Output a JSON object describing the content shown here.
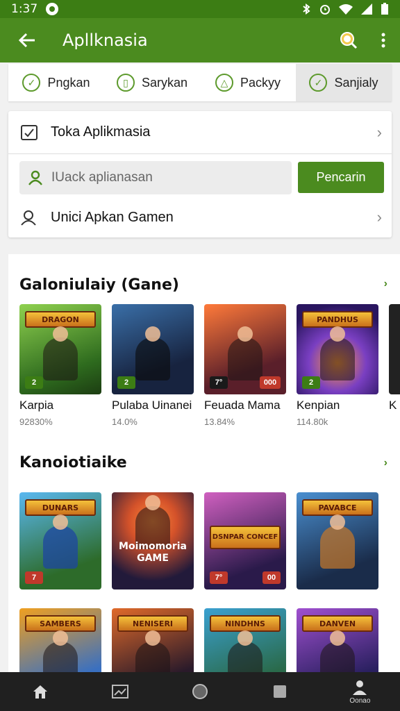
{
  "status_bar": {
    "time": "1:37"
  },
  "app_bar": {
    "title": "Apllknasia",
    "back_icon": "arrow-left-icon",
    "search_icon": "search-icon",
    "more_icon": "more-vert-icon"
  },
  "tabs": [
    {
      "label": "Pngkan",
      "icon": "check-circle-icon",
      "active": false
    },
    {
      "label": "Sarykan",
      "icon": "bag-icon",
      "active": false
    },
    {
      "label": "Packyy",
      "icon": "alert-icon",
      "active": false
    },
    {
      "label": "Sanjialy",
      "icon": "check-circle-icon",
      "active": true
    }
  ],
  "tools": {
    "toka_label": "Toka Aplikmasia",
    "search_placeholder": "IUack aplianasan",
    "search_button": "Pencarin",
    "games_label": "Unici Apkan Gamen"
  },
  "section1": {
    "title": "Galoniulaiy (Gane)",
    "games": [
      {
        "name": "Karpia",
        "stat": "92830%",
        "banner": "DRAGON",
        "badge_left": "2",
        "badge_right": "",
        "colors": [
          "#6fbf3a",
          "#2e6b1e"
        ]
      },
      {
        "name": "Pulaba Uinanei",
        "stat": "14.0%",
        "banner": "",
        "badge_left": "2",
        "badge_right": "",
        "colors": [
          "#274a78",
          "#17233f"
        ]
      },
      {
        "name": "Feuada Mama",
        "stat": "13.84%",
        "banner": "",
        "badge_left": "7°",
        "badge_right": "000",
        "colors": [
          "#e0502a",
          "#5a1f2a"
        ]
      },
      {
        "name": "Kenpian",
        "stat": "114.80k",
        "banner": "PANDHUS",
        "badge_left": "2",
        "badge_right": "",
        "colors": [
          "#7a3fc2",
          "#2a1660"
        ]
      },
      {
        "name": "K",
        "stat": "",
        "banner": "",
        "badge_left": "",
        "badge_right": "",
        "colors": [
          "#333",
          "#111"
        ]
      }
    ]
  },
  "section2": {
    "title": "Kanoiotiaike",
    "games": [
      {
        "banner": "DUNARS",
        "text": "",
        "badge_left": "7",
        "badge_right": "",
        "colors": [
          "#3a9bd8",
          "#2d6b2a"
        ]
      },
      {
        "banner": "",
        "text": "Moimomoria GAME",
        "badge_left": "",
        "badge_right": "",
        "colors": [
          "#d4522a",
          "#221a3a"
        ]
      },
      {
        "banner": "DSNPAR CONCEF",
        "text": "",
        "badge_left": "7°",
        "badge_right": "00",
        "colors": [
          "#b04aa0",
          "#2a1a4a"
        ]
      },
      {
        "banner": "PAVABCE",
        "text": "",
        "badge_left": "",
        "badge_right": "",
        "colors": [
          "#2f6fb0",
          "#1a2c4a"
        ]
      }
    ],
    "games_row2": [
      {
        "banner": "SAMBERS",
        "colors": [
          "#f0a020",
          "#3a70c0"
        ]
      },
      {
        "banner": "NENISERI",
        "colors": [
          "#e06a2a",
          "#2a1a2a"
        ]
      },
      {
        "banner": "NINDHNS",
        "colors": [
          "#3aa0d0",
          "#2a6a4a"
        ]
      },
      {
        "banner": "DANVEN",
        "colors": [
          "#a050d0",
          "#2a2060"
        ]
      }
    ]
  },
  "bottom_nav": [
    {
      "icon": "home-icon",
      "label": ""
    },
    {
      "icon": "image-icon",
      "label": ""
    },
    {
      "icon": "circle-icon",
      "label": ""
    },
    {
      "icon": "square-icon",
      "label": ""
    },
    {
      "icon": "person-icon",
      "label": "Oonao"
    }
  ]
}
